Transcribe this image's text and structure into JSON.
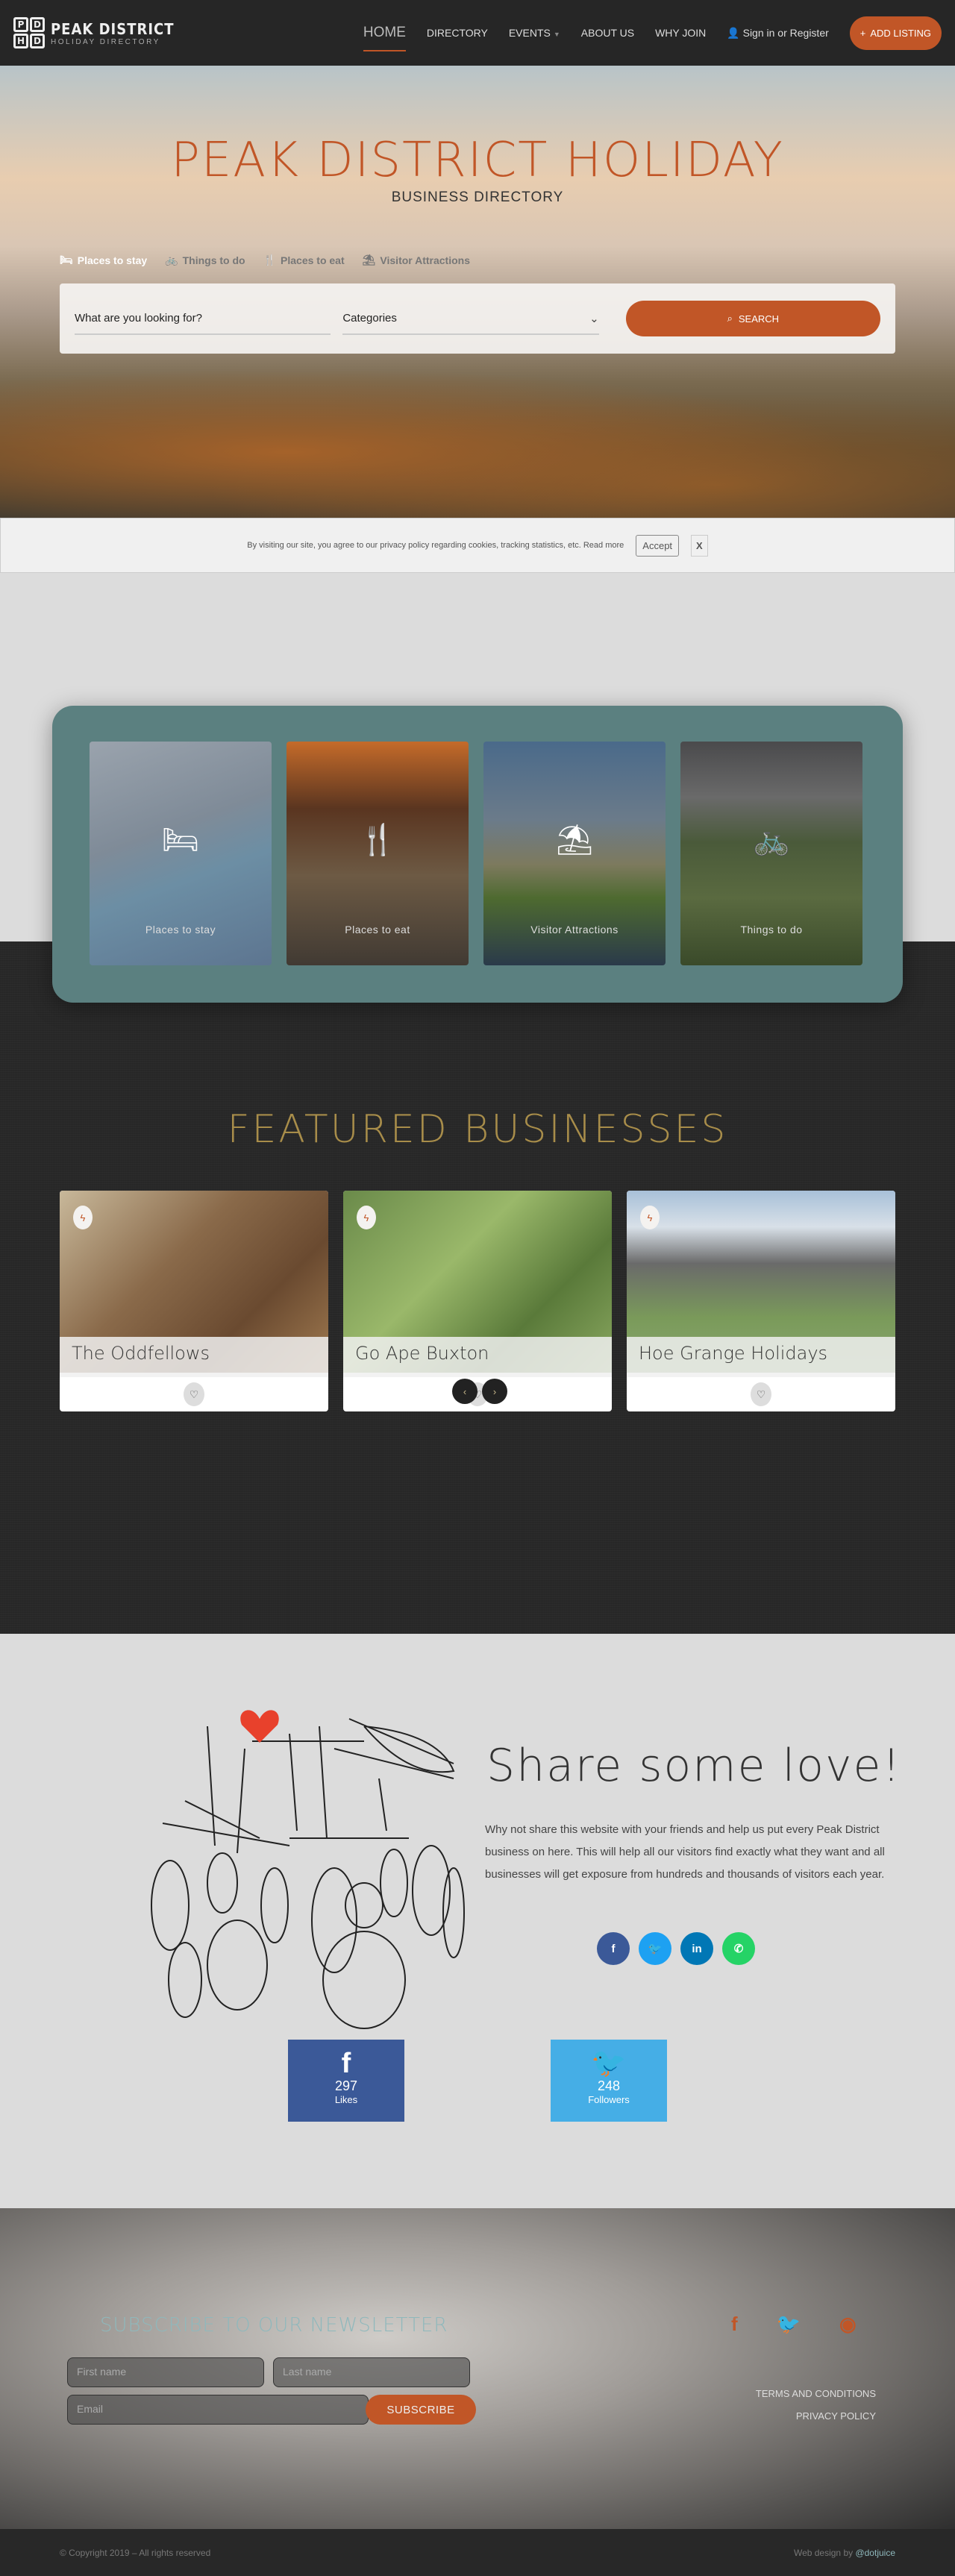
{
  "nav": {
    "logo_letters": [
      "P",
      "D",
      "H",
      "D"
    ],
    "logo_title": "PEAK DISTRICT",
    "logo_subtitle": "HOLIDAY DIRECTORY",
    "items": [
      {
        "label": "HOME",
        "active": true
      },
      {
        "label": "DIRECTORY"
      },
      {
        "label": "EVENTS",
        "dropdown": true
      },
      {
        "label": "ABOUT US"
      },
      {
        "label": "WHY JOIN"
      }
    ],
    "signin_label": "Sign in or Register",
    "add_listing_label": "ADD LISTING"
  },
  "hero": {
    "title": "PEAK DISTRICT HOLIDAY",
    "subtitle": "BUSINESS DIRECTORY",
    "tabs": [
      {
        "label": "Places to stay",
        "icon": "bed-icon",
        "active": true
      },
      {
        "label": "Things to do",
        "icon": "bicycle-icon"
      },
      {
        "label": "Places to eat",
        "icon": "cutlery-icon"
      },
      {
        "label": "Visitor Attractions",
        "icon": "parasol-icon"
      }
    ],
    "search_placeholder": "What are you looking for?",
    "categories_label": "Categories",
    "search_button": "SEARCH"
  },
  "cookie": {
    "text": "By visiting our site, you agree to our privacy policy regarding cookies, tracking statistics, etc. Read more",
    "accept": "Accept",
    "close": "X"
  },
  "categories": [
    {
      "label": "Places to stay",
      "icon": "bed-icon"
    },
    {
      "label": "Places to eat",
      "icon": "cutlery-icon"
    },
    {
      "label": "Visitor Attractions",
      "icon": "parasol-icon"
    },
    {
      "label": "Things to do",
      "icon": "bicycle-icon"
    }
  ],
  "featured": {
    "title": "FEATURED BUSINESSES",
    "cards": [
      {
        "name": "The Oddfellows"
      },
      {
        "name": "Go Ape Buxton"
      },
      {
        "name": "Hoe Grange Holidays"
      }
    ],
    "prev": "‹",
    "next": "›"
  },
  "share": {
    "title": "Share some love!",
    "text": "Why not share this website with your friends and help us put every Peak District business on here. This will help all our visitors find exactly what they want and all businesses will get exposure from hundreds and thousands of visitors each year.",
    "buttons": [
      {
        "name": "facebook",
        "glyph": "f",
        "color": "#3b5998"
      },
      {
        "name": "twitter",
        "glyph": "t",
        "color": "#1da1f2"
      },
      {
        "name": "linkedin",
        "glyph": "in",
        "color": "#0077b5"
      },
      {
        "name": "whatsapp",
        "glyph": "✆",
        "color": "#25d366"
      }
    ],
    "facebook": {
      "count": "297",
      "label": "Likes",
      "color": "#3b5998"
    },
    "twitter": {
      "count": "248",
      "label": "Followers",
      "color": "#45aee6"
    }
  },
  "footer": {
    "newsletter_title": "SUBSCRIBE TO OUR NEWSLETTER",
    "first_name_placeholder": "First name",
    "last_name_placeholder": "Last name",
    "email_placeholder": "Email",
    "subscribe_button": "SUBSCRIBE",
    "links": [
      "TERMS AND CONDITIONS",
      "PRIVACY POLICY"
    ],
    "copyright": "© Copyright 2019 – All rights reserved",
    "credit_prefix": "Web design by ",
    "credit_link": "@dotjuice"
  },
  "colors": {
    "accent": "#c15627",
    "teal": "#5b8080",
    "gold": "#a88d4a"
  }
}
